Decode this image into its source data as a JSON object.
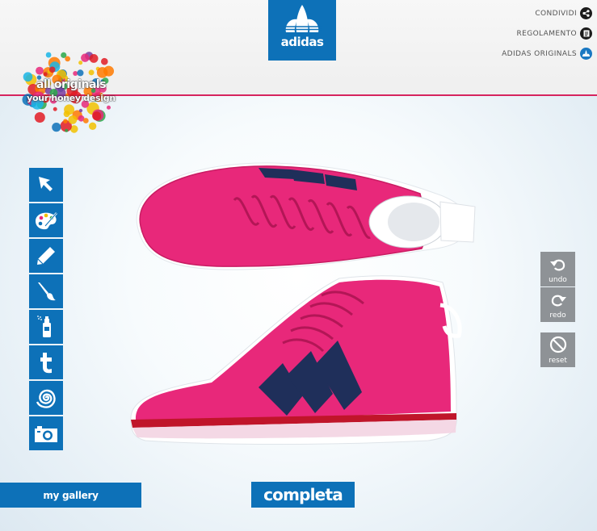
{
  "brand": {
    "name": "adidas"
  },
  "links": [
    {
      "label": "CONDIVIDI",
      "icon": "share-icon"
    },
    {
      "label": "REGOLAMENTO",
      "icon": "document-icon"
    },
    {
      "label": "ADIDAS ORIGINALS",
      "icon": "trefoil-icon"
    }
  ],
  "badge": {
    "line1": "all originals",
    "line2": "your honey design"
  },
  "tools": [
    {
      "name": "select-tool",
      "icon": "cursor-arrow-icon"
    },
    {
      "name": "palette-tool",
      "icon": "palette-icon"
    },
    {
      "name": "pencil-tool",
      "icon": "pencil-icon"
    },
    {
      "name": "brush-tool",
      "icon": "brush-icon"
    },
    {
      "name": "spray-tool",
      "icon": "spray-can-icon"
    },
    {
      "name": "text-tool",
      "icon": "text-t-icon"
    },
    {
      "name": "pattern-tool",
      "icon": "spiral-icon"
    },
    {
      "name": "photo-tool",
      "icon": "camera-icon"
    }
  ],
  "actions": {
    "undo": "undo",
    "redo": "redo",
    "reset": "reset"
  },
  "footer": {
    "gallery": "my gallery",
    "complete": "completa"
  },
  "colors": {
    "blue": "#0d71b8",
    "shoe_pink": "#e8287a",
    "stripe_navy": "#1f2f5a",
    "accent_line": "#d6245e"
  }
}
